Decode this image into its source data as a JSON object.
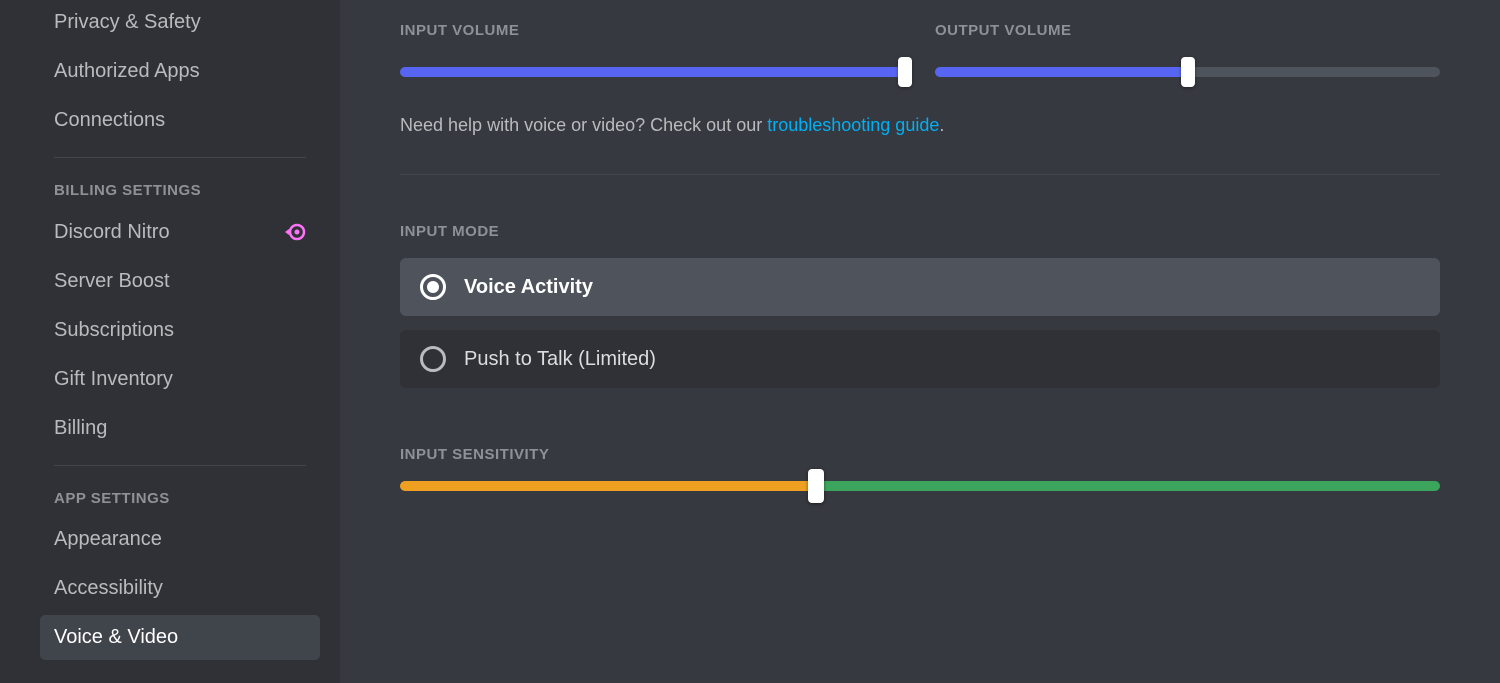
{
  "sidebar": {
    "top_items": [
      {
        "label": "Privacy & Safety",
        "name": "privacy-safety"
      },
      {
        "label": "Authorized Apps",
        "name": "authorized-apps"
      },
      {
        "label": "Connections",
        "name": "connections"
      }
    ],
    "billing_header": "BILLING SETTINGS",
    "billing_items": [
      {
        "label": "Discord Nitro",
        "name": "discord-nitro",
        "nitro_icon": true
      },
      {
        "label": "Server Boost",
        "name": "server-boost"
      },
      {
        "label": "Subscriptions",
        "name": "subscriptions"
      },
      {
        "label": "Gift Inventory",
        "name": "gift-inventory"
      },
      {
        "label": "Billing",
        "name": "billing"
      }
    ],
    "app_header": "APP SETTINGS",
    "app_items": [
      {
        "label": "Appearance",
        "name": "appearance"
      },
      {
        "label": "Accessibility",
        "name": "accessibility"
      },
      {
        "label": "Voice & Video",
        "name": "voice-video",
        "active": true
      }
    ]
  },
  "volume": {
    "input_label": "INPUT VOLUME",
    "output_label": "OUTPUT VOLUME",
    "input_percent": 100,
    "output_percent": 50
  },
  "help": {
    "prefix": "Need help with voice or video? Check out our ",
    "link_text": "troubleshooting guide",
    "suffix": "."
  },
  "input_mode": {
    "label": "INPUT MODE",
    "options": [
      {
        "label": "Voice Activity",
        "selected": true,
        "name": "voice-activity"
      },
      {
        "label": "Push to Talk (Limited)",
        "selected": false,
        "name": "push-to-talk"
      }
    ]
  },
  "sensitivity": {
    "label": "INPUT SENSITIVITY",
    "threshold_percent": 40
  }
}
